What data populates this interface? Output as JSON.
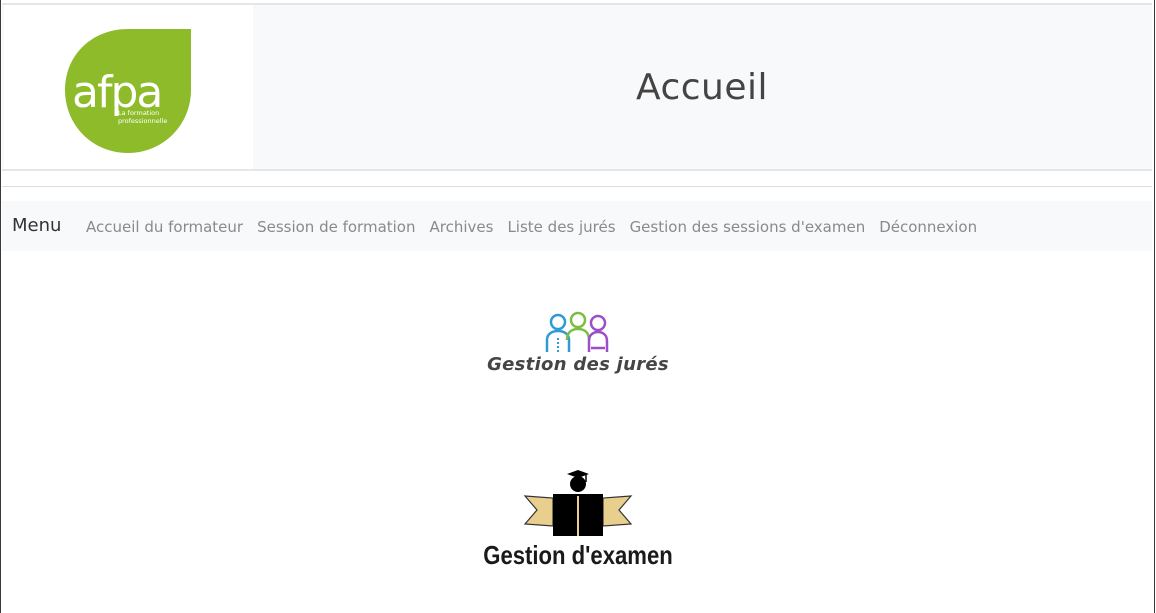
{
  "header": {
    "logo": {
      "brand": "afpa",
      "tagline_1": "La formation",
      "tagline_2": "professionnelle",
      "color": "#8dbb2a"
    },
    "title": "Accueil"
  },
  "nav": {
    "menu_label": "Menu",
    "links": [
      "Accueil du formateur",
      "Session de formation",
      "Archives",
      "Liste des jurés",
      "Gestion des sessions d'examen",
      "Déconnexion"
    ]
  },
  "tiles": {
    "juries": {
      "caption": "Gestion des jurés",
      "icon": "people-icon",
      "colors": [
        "#2f9bd6",
        "#7cbd42",
        "#9c4fc7"
      ]
    },
    "exam": {
      "caption": "Gestion d'examen",
      "icon": "graduate-book-icon",
      "colors": [
        "#000000",
        "#e8cf8e"
      ]
    }
  }
}
